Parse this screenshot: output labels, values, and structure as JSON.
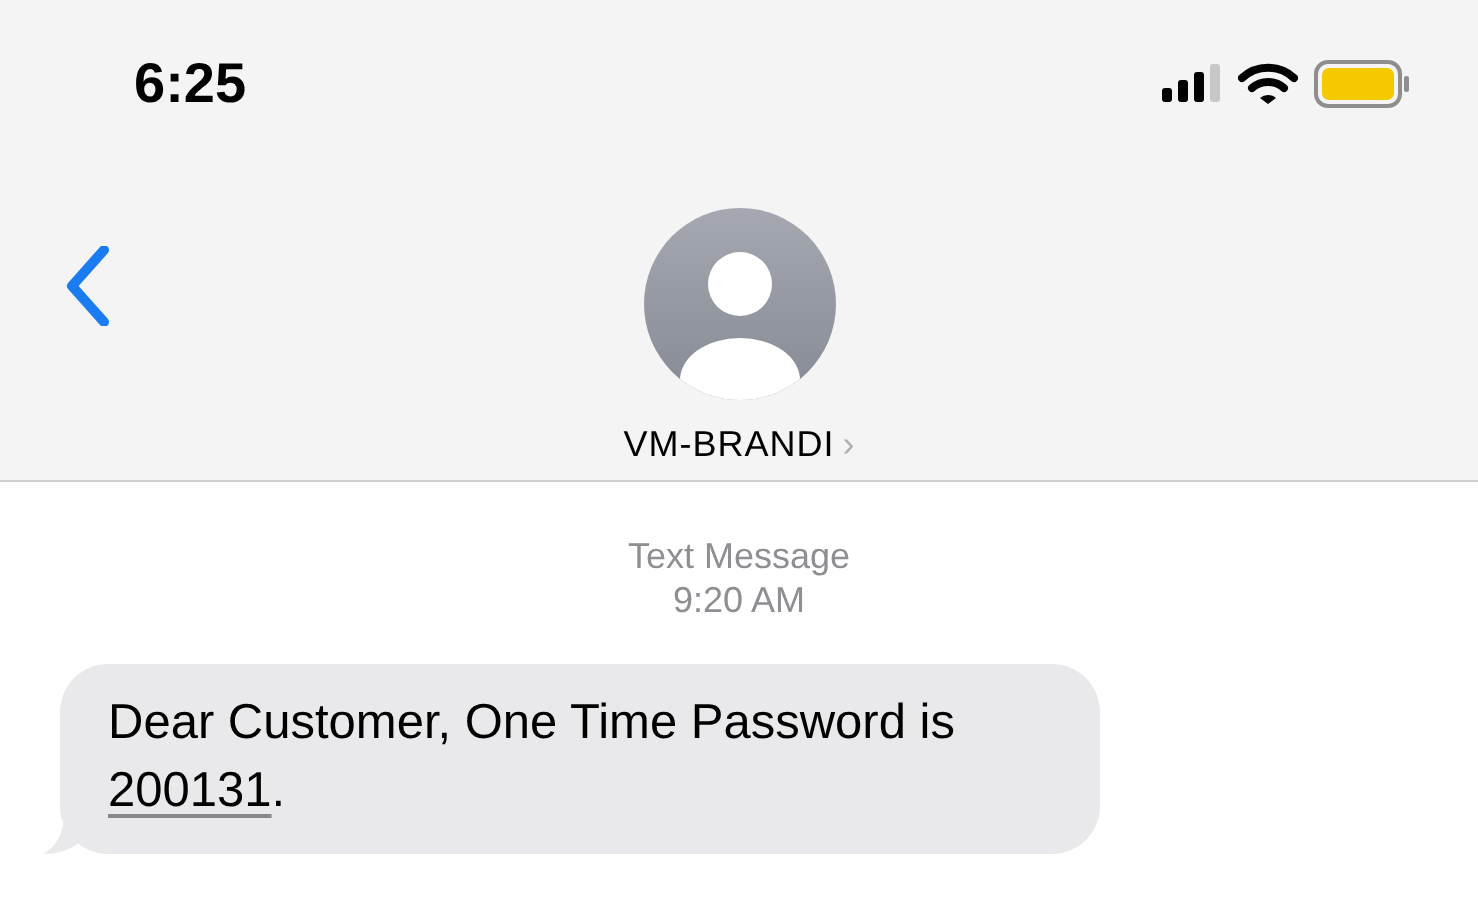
{
  "status_bar": {
    "time": "6:25"
  },
  "contact": {
    "name": "VM-BRANDI",
    "chevron": "›"
  },
  "thread": {
    "service": "Text Message",
    "time": "9:20 AM"
  },
  "messages": [
    {
      "parts": [
        {
          "kind": "text",
          "text": "Dear Customer, One Time Password is "
        },
        {
          "kind": "link",
          "text": "200131"
        },
        {
          "kind": "text",
          "text": "."
        }
      ]
    }
  ]
}
